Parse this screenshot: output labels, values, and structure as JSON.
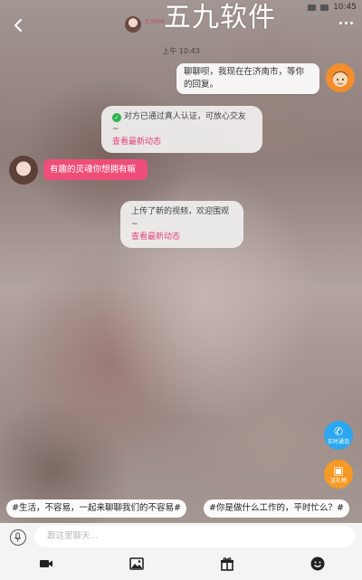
{
  "status_bar": {
    "time": "10:45"
  },
  "watermark": "五九软件",
  "header": {
    "subtitle": "5.8KM"
  },
  "messages": {
    "time": "上午 10:43",
    "outgoing": "聊聊呗，我现在在济南市，等你的回复。",
    "verify_notice": "对方已通过真人认证，可放心交友~",
    "verify_link": "查看最新动态",
    "incoming": "有趣的灵魂你想拥有嘛",
    "video_notice": "上传了新的视频，欢迎围观~",
    "video_link": "查看最新动态"
  },
  "fab": {
    "call_label": "实时通话",
    "gift_label": "送礼物"
  },
  "topics": [
    "#生活，不容易，一起来聊聊我们的不容易#",
    "#你是做什么工作的，平时忙么？#"
  ],
  "input": {
    "placeholder": "跟这里聊天..."
  },
  "icons": [
    "microphone-icon",
    "video-icon",
    "image-icon",
    "gift-icon",
    "emoji-icon"
  ],
  "colors": {
    "accent_pink": "#ee4e79",
    "call_blue": "#2aa7ee",
    "gift_orange": "#f59a24"
  }
}
